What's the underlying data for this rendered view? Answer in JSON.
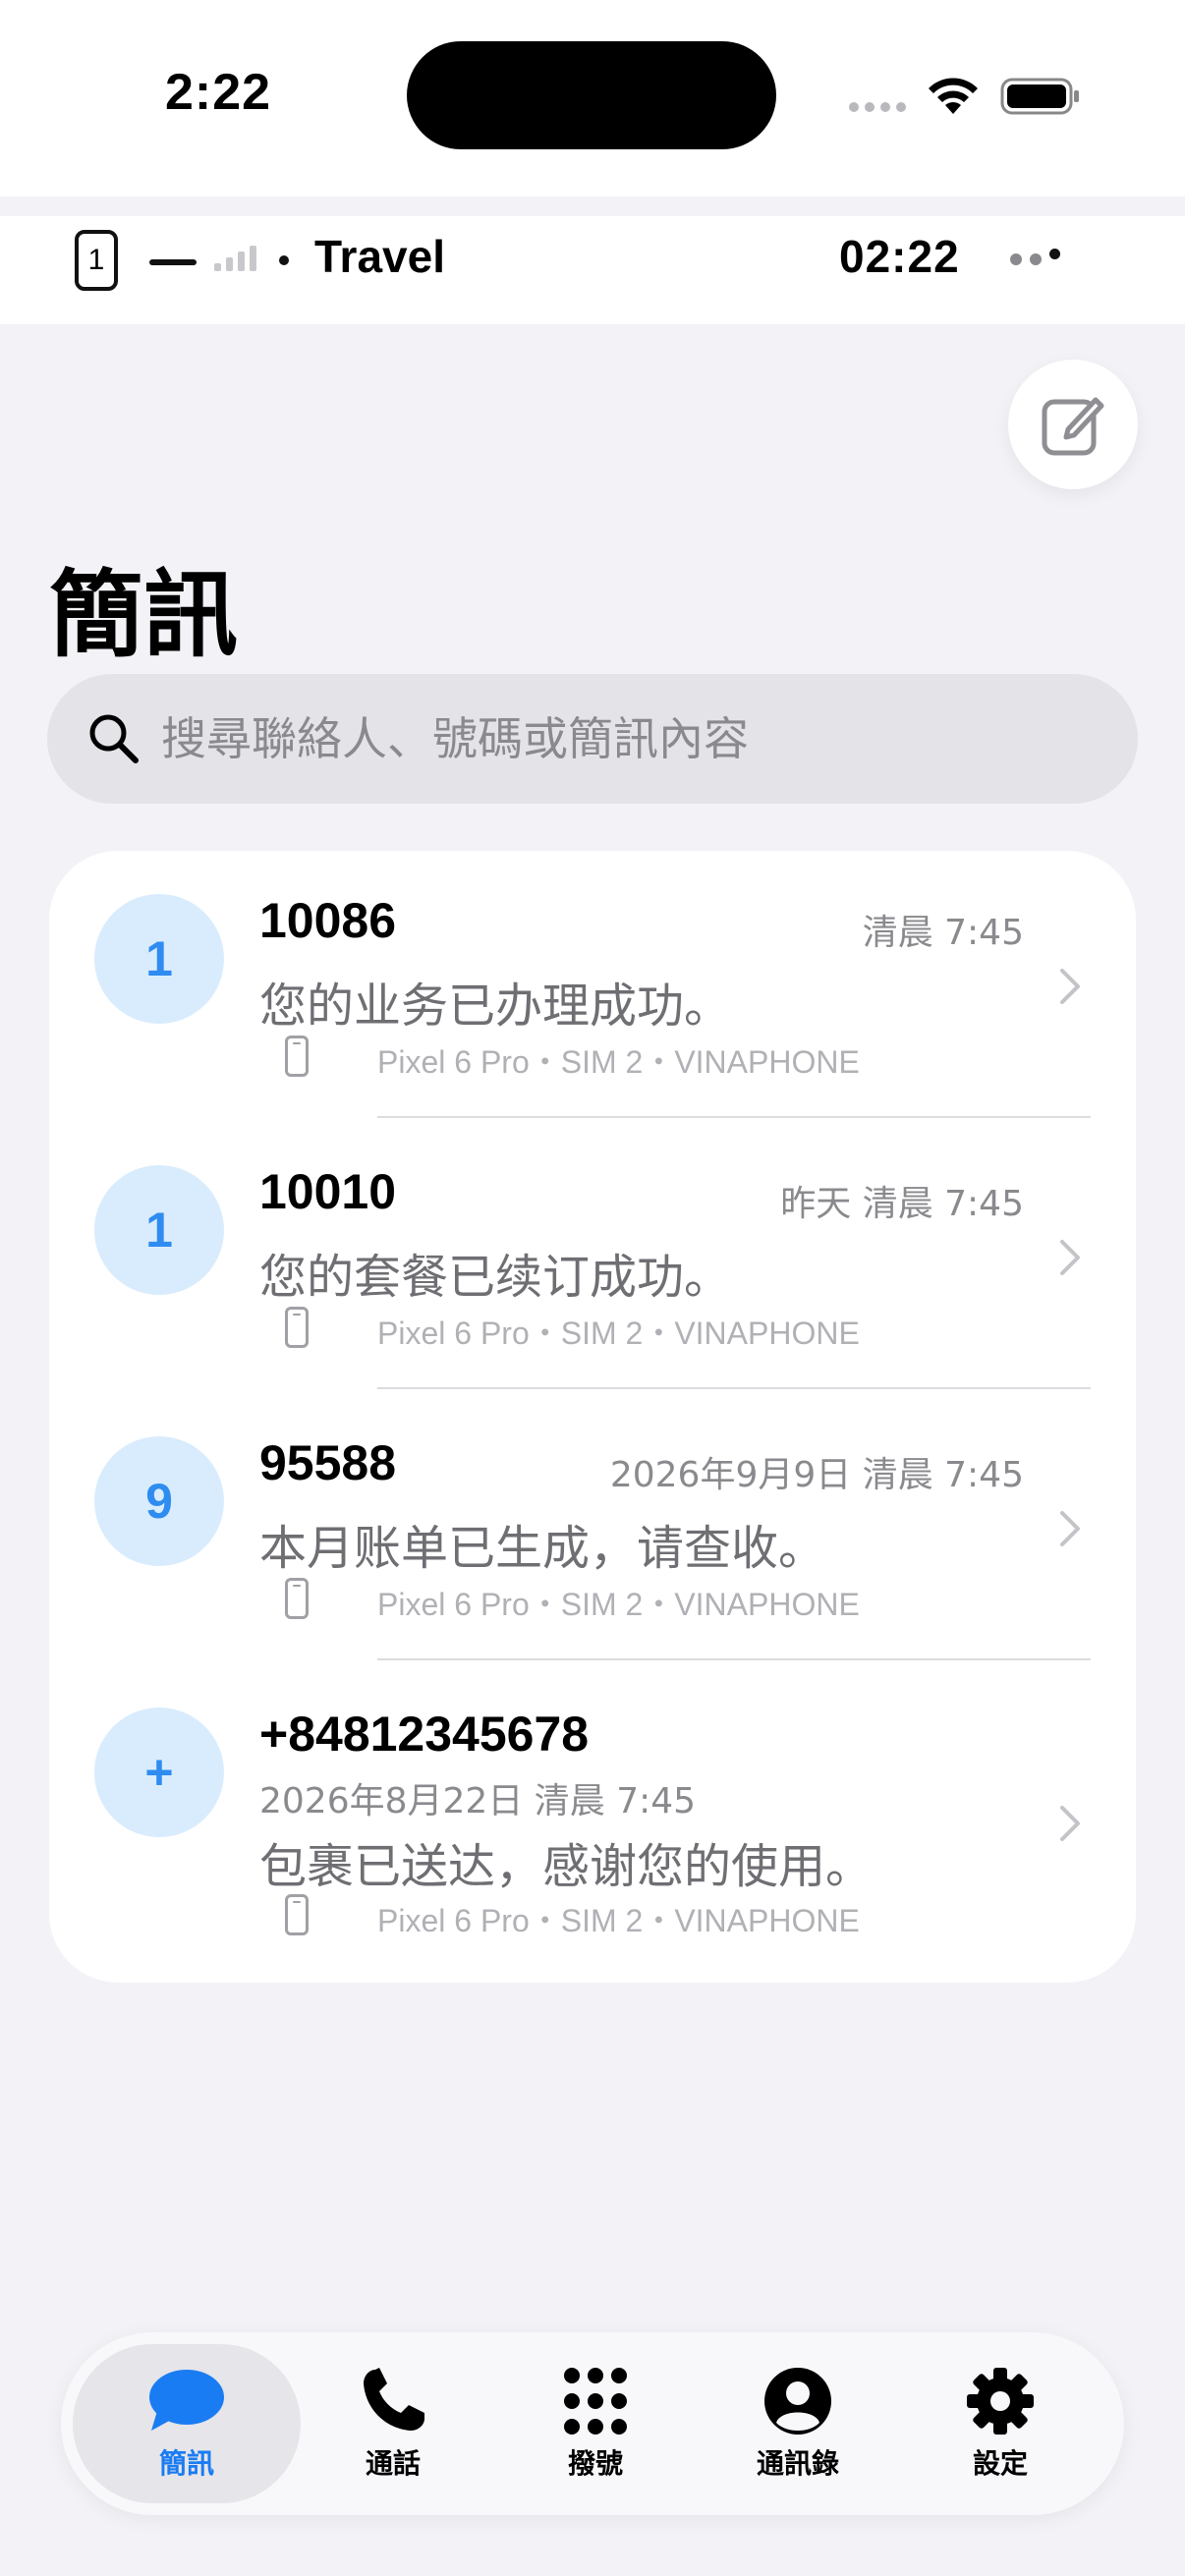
{
  "status_bar": {
    "time": "2:22"
  },
  "sim_bar": {
    "sim_slot": "1",
    "line_name": "Travel",
    "clock": "02:22"
  },
  "page": {
    "title": "簡訊"
  },
  "search": {
    "placeholder": "搜尋聯絡人、號碼或簡訊內容"
  },
  "messages": [
    {
      "avatar": "1",
      "sender": "10086",
      "timestamp": "清晨 7:45",
      "preview": "您的业务已办理成功。",
      "sim_info": "Pixel 6 Pro・SIM 2・VINAPHONE"
    },
    {
      "avatar": "1",
      "sender": "10010",
      "timestamp": "昨天 清晨 7:45",
      "preview": "您的套餐已续订成功。",
      "sim_info": "Pixel 6 Pro・SIM 2・VINAPHONE"
    },
    {
      "avatar": "9",
      "sender": "95588",
      "timestamp": "2026年9月9日 清晨 7:45",
      "preview": "本月账单已生成，请查收。",
      "sim_info": "Pixel 6 Pro・SIM 2・VINAPHONE"
    },
    {
      "avatar": "+",
      "sender": "+84812345678",
      "timestamp": "2026年8月22日 清晨 7:45",
      "preview": "包裹已送达，感谢您的使用。",
      "sim_info": "Pixel 6 Pro・SIM 2・VINAPHONE"
    }
  ],
  "tabs": [
    {
      "label": "簡訊",
      "icon": "message-bubble-icon",
      "active": true
    },
    {
      "label": "通話",
      "icon": "phone-icon",
      "active": false
    },
    {
      "label": "撥號",
      "icon": "keypad-icon",
      "active": false
    },
    {
      "label": "通訊錄",
      "icon": "contact-icon",
      "active": false
    },
    {
      "label": "設定",
      "icon": "gear-icon",
      "active": false
    }
  ],
  "colors": {
    "accent": "#1a7cf2",
    "avatar_bg": "#d9ecfd",
    "background": "#f2f2f7"
  }
}
